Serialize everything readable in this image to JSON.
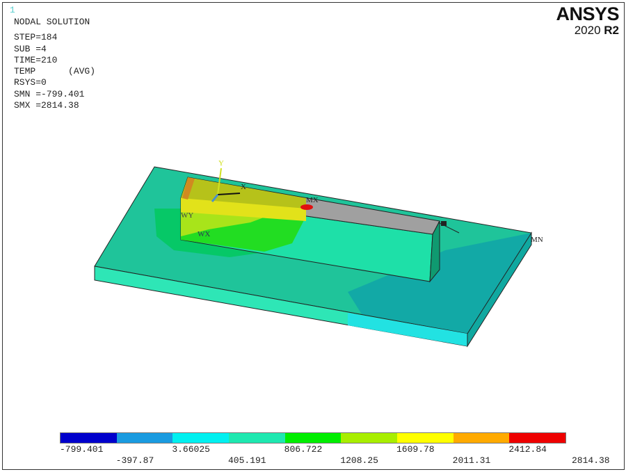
{
  "window_number": "1",
  "info": {
    "title": "NODAL SOLUTION",
    "step": "STEP=184",
    "sub": "SUB =4",
    "time": "TIME=210",
    "item": "TEMP",
    "avg": "(AVG)",
    "rsys": "RSYS=0",
    "smn": "SMN =-799.401",
    "smx": "SMX =2814.38"
  },
  "logo": {
    "brand": "ANSYS",
    "version": "2020",
    "release": "R2"
  },
  "model_labels": {
    "y_axis": "Y",
    "x_axis": "X",
    "mx": "MX",
    "wy": "WY",
    "wx": "WX",
    "mn": "MN"
  },
  "legend": {
    "colors": [
      "#0000cc",
      "#1a9be0",
      "#00f0f0",
      "#1ee8b0",
      "#00ee00",
      "#a8ee00",
      "#ffff00",
      "#ffaa00",
      "#ee0000"
    ],
    "labels_top": [
      "-799.401",
      "3.66025",
      "806.722",
      "1609.78",
      "2412.84"
    ],
    "labels_bottom": [
      "-397.87",
      "405.191",
      "1208.25",
      "2011.31",
      "2814.38"
    ]
  }
}
